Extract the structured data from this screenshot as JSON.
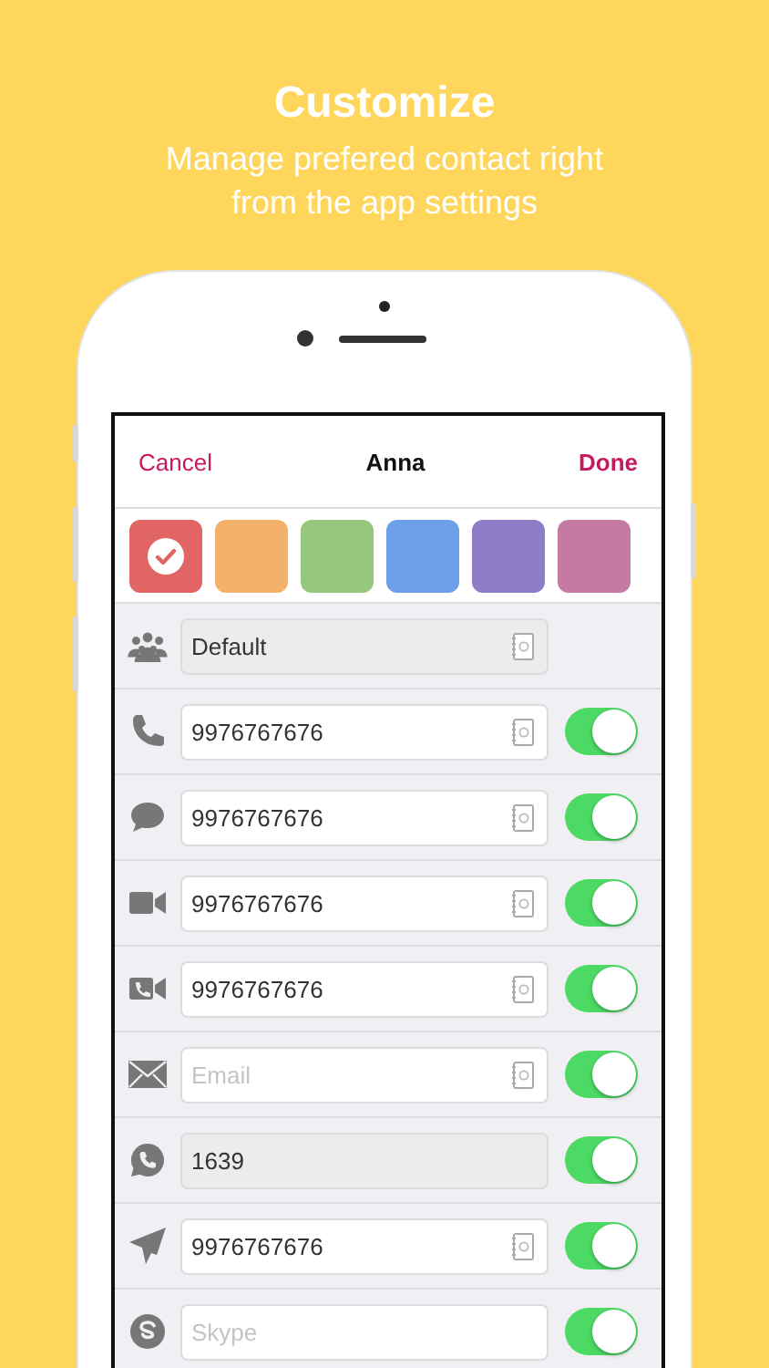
{
  "header": {
    "title": "Customize",
    "subtitle": "Manage prefered contact right from the app settings"
  },
  "nav": {
    "cancel": "Cancel",
    "title": "Anna",
    "done": "Done"
  },
  "colors": [
    {
      "color": "#e26565",
      "selected": true
    },
    {
      "color": "#f5b06a",
      "selected": false
    },
    {
      "color": "#97c67f",
      "selected": false
    },
    {
      "color": "#6c9fe8",
      "selected": false
    },
    {
      "color": "#8e7cc6",
      "selected": false
    },
    {
      "color": "#c47aa3",
      "selected": false
    }
  ],
  "rows": [
    {
      "kind": "group",
      "value": "Default",
      "disabled": true,
      "contact_picker": true
    },
    {
      "kind": "phone",
      "value": "9976767676",
      "disabled": false,
      "contact_picker": true,
      "on": true
    },
    {
      "kind": "message",
      "value": "9976767676",
      "disabled": false,
      "contact_picker": true,
      "on": true
    },
    {
      "kind": "video",
      "value": "9976767676",
      "disabled": false,
      "contact_picker": true,
      "on": true
    },
    {
      "kind": "video-call",
      "value": "9976767676",
      "disabled": false,
      "contact_picker": true,
      "on": true
    },
    {
      "kind": "email",
      "placeholder": "Email",
      "disabled": false,
      "contact_picker": true,
      "on": true
    },
    {
      "kind": "whatsapp",
      "value": "1639",
      "disabled": true,
      "contact_picker": false,
      "on": true
    },
    {
      "kind": "telegram",
      "value": "9976767676",
      "disabled": false,
      "contact_picker": true,
      "on": true
    },
    {
      "kind": "skype",
      "placeholder": "Skype",
      "disabled": false,
      "contact_picker": false,
      "on": true
    }
  ]
}
